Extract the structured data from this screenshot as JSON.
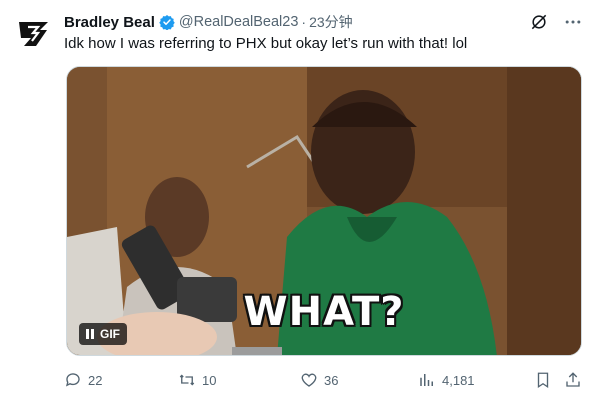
{
  "tweet": {
    "author_name": "Bradley Beal",
    "handle": "@RealDealBeal23",
    "separator": "·",
    "time": "23分钟",
    "text": "Idk how I was referring to PHX but okay let’s run with that! lol",
    "media": {
      "caption": "WHAT?",
      "badge": "GIF"
    },
    "stats": {
      "replies": "22",
      "reposts": "10",
      "likes": "36",
      "views": "4,181"
    }
  },
  "colors": {
    "verified": "#1d9bf0",
    "muted": "#536471",
    "text": "#0f1419"
  },
  "icons": [
    "avatar-logo",
    "verified-badge-icon",
    "grok-icon",
    "more-icon",
    "reply-icon",
    "repost-icon",
    "like-icon",
    "views-icon",
    "bookmark-icon",
    "share-icon",
    "pause-icon"
  ]
}
